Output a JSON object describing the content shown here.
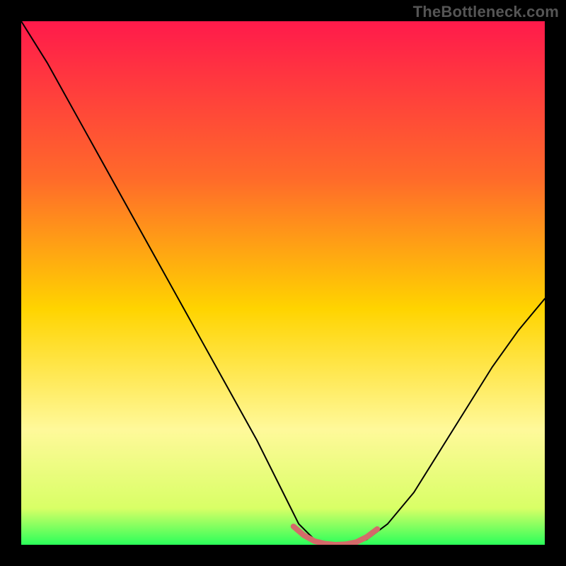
{
  "watermark": "TheBottleneck.com",
  "chart_data": {
    "type": "line",
    "title": "",
    "xlabel": "",
    "ylabel": "",
    "xlim": [
      0,
      100
    ],
    "ylim": [
      0,
      100
    ],
    "background_gradient": {
      "stops": [
        {
          "offset": 0,
          "color": "#ff1a4b"
        },
        {
          "offset": 30,
          "color": "#ff6a2a"
        },
        {
          "offset": 55,
          "color": "#ffd400"
        },
        {
          "offset": 78,
          "color": "#fff99a"
        },
        {
          "offset": 93,
          "color": "#d9ff66"
        },
        {
          "offset": 100,
          "color": "#2bff5a"
        }
      ]
    },
    "series": [
      {
        "name": "bottleneck-curve",
        "color": "#000000",
        "stroke_width": 2,
        "x": [
          0,
          5,
          10,
          15,
          20,
          25,
          30,
          35,
          40,
          45,
          50,
          53,
          56,
          60,
          63,
          66,
          70,
          75,
          80,
          85,
          90,
          95,
          100
        ],
        "values": [
          100,
          92,
          83,
          74,
          65,
          56,
          47,
          38,
          29,
          20,
          10,
          4,
          1,
          0,
          0,
          1,
          4,
          10,
          18,
          26,
          34,
          41,
          47
        ]
      },
      {
        "name": "optimal-zone",
        "color": "#d46a6a",
        "stroke_width": 8,
        "x": [
          52,
          54,
          56,
          58,
          60,
          62,
          64,
          66,
          68
        ],
        "values": [
          3.5,
          1.8,
          0.7,
          0.2,
          0.0,
          0.1,
          0.5,
          1.5,
          3.0
        ]
      }
    ]
  }
}
